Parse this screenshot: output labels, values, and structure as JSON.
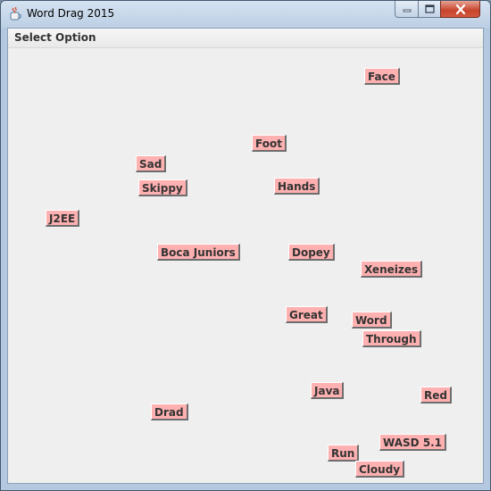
{
  "window": {
    "title": "Word Drag 2015"
  },
  "menu": {
    "items": [
      "Select Option"
    ]
  },
  "words": [
    "Face",
    "Foot",
    "Sad",
    "Skippy",
    "Hands",
    "J2EE",
    "Boca Juniors",
    "Dopey",
    "Xeneizes",
    "Great",
    "Word",
    "Through",
    "Java",
    "Red",
    "Drad",
    "WASD 5.1",
    "Run",
    "Cloudy"
  ],
  "colors": {
    "word_background": "#ffb0b0",
    "canvas_background": "#efefef",
    "close_button": "#c8432c"
  }
}
